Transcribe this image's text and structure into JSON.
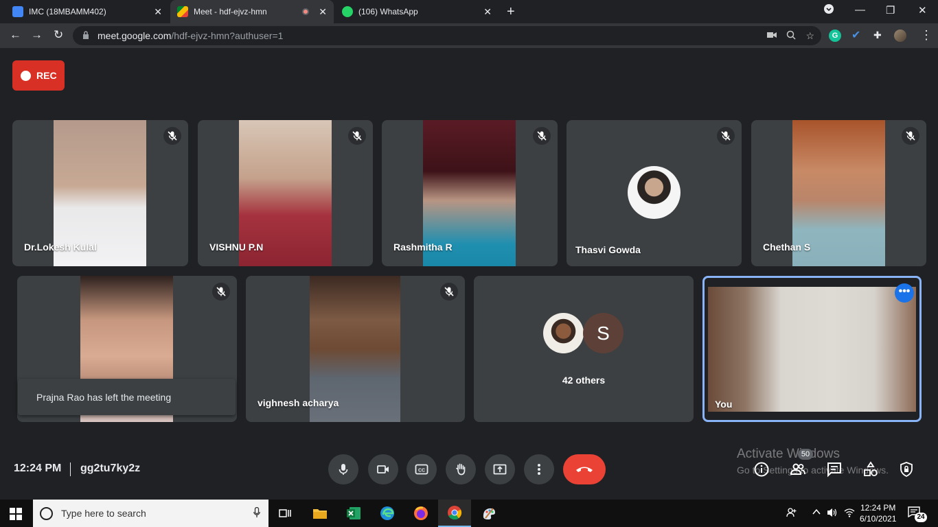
{
  "browser": {
    "tabs": [
      {
        "title": "IMC (18MBAMM402)",
        "close": "✕"
      },
      {
        "title": "Meet - hdf-ejvz-hmn",
        "close": "✕"
      },
      {
        "title": "(106) WhatsApp",
        "close": "✕"
      }
    ],
    "new_tab": "+",
    "url_host": "meet.google.com",
    "url_path": "/hdf-ejvz-hmn?authuser=1",
    "extension_g": "G"
  },
  "meeting": {
    "rec_label": "REC",
    "time": "12:24 PM",
    "code": "gg2tu7ky2z",
    "participants": [
      {
        "name": "Dr.Lokesh Kulal",
        "muted": true
      },
      {
        "name": "VISHNU P.N",
        "muted": true
      },
      {
        "name": "Rashmitha R",
        "muted": true
      },
      {
        "name": "Thasvi Gowda",
        "muted": true
      },
      {
        "name": "Chethan S",
        "muted": true
      },
      {
        "name": "",
        "muted": true
      },
      {
        "name": "vighnesh acharya",
        "muted": true
      }
    ],
    "others_initial": "S",
    "others_label": "42 others",
    "self_label": "You",
    "more_label": "•••",
    "toast": "Prajna Rao has left the meeting",
    "people_count": "50"
  },
  "watermark": {
    "line1": "Activate Windows",
    "line2": "Go to Settings to activate Windows."
  },
  "taskbar": {
    "search_placeholder": "Type here to search",
    "time": "12:24 PM",
    "date": "6/10/2021",
    "notifications": "24"
  },
  "colors": {
    "background": "#202124",
    "tile": "#3c4043",
    "rec": "#d93025",
    "hangup": "#ea4335",
    "accent": "#8ab4f8"
  }
}
